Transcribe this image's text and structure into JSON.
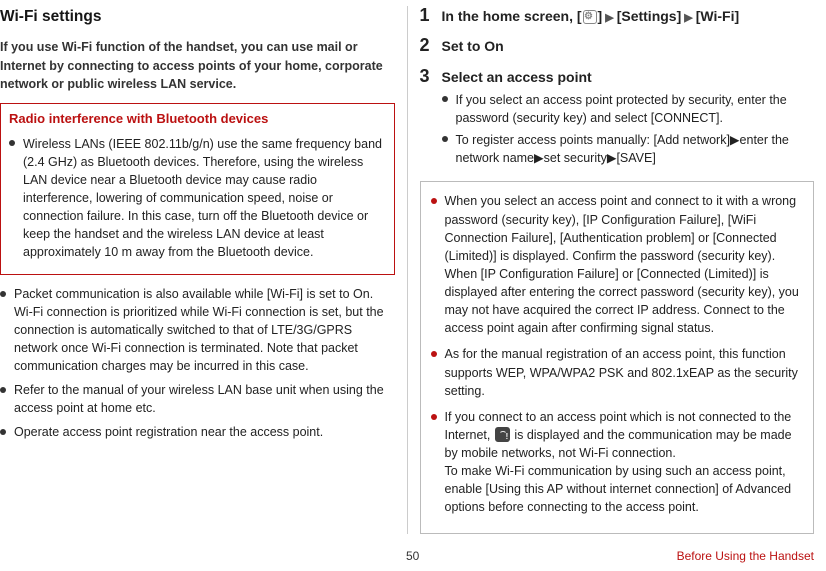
{
  "left": {
    "heading": "Wi-Fi settings",
    "intro": "If you use Wi-Fi function of the handset, you can use mail or Internet by connecting to access points of your home, corporate network or public wireless LAN service.",
    "radioBox": {
      "title": "Radio interference with Bluetooth devices",
      "body": "Wireless LANs (IEEE 802.11b/g/n) use the same frequency band (2.4 GHz) as Bluetooth devices. Therefore, using the wireless LAN device near a Bluetooth device may cause radio interference, lowering of communication speed, noise or connection failure. In this case, turn off the Bluetooth device or keep the handset and the wireless LAN device at least approximately 10 m away from the Bluetooth device."
    },
    "bullets": [
      "Packet communication is also available while [Wi-Fi] is set to On. Wi-Fi connection is prioritized while Wi-Fi connection is set, but the connection is automatically switched to that of LTE/3G/GPRS network once Wi-Fi connection is terminated. Note that packet communication charges may be incurred in this case.",
      "Refer to the manual of your wireless LAN base unit when using the access point at home etc.",
      "Operate access point registration near the access point."
    ]
  },
  "right": {
    "steps": [
      {
        "num": "1",
        "title_pre": "In the home screen, [",
        "title_mid1": "]",
        "title_mid2": "[Settings]",
        "title_tail": "[Wi-Fi]"
      },
      {
        "num": "2",
        "title": "Set to On"
      },
      {
        "num": "3",
        "title": "Select an access point",
        "subs": [
          "If you select an access point protected by security, enter the password (security key) and select [CONNECT].",
          "To register access points manually: [Add network]▶enter the network name▶set security▶[SAVE]"
        ]
      }
    ],
    "notes": [
      "When you select an access point and connect to it with a wrong password (security key), [IP Configuration Failure], [WiFi Connection Failure], [Authentication problem] or [Connected (Limited)] is displayed. Confirm the password (security key). When [IP Configuration Failure] or [Connected (Limited)] is displayed after entering the correct password (security key), you may not have acquired the correct IP address. Connect to the access point again after confirming signal status.",
      "As for the manual registration of an access point, this function supports WEP, WPA/WPA2 PSK and 802.1xEAP as the security setting.",
      "If you connect to an access point which is not connected to the Internet, [__ICON__] is displayed and the communication may be made by mobile networks, not Wi-Fi connection.\nTo make Wi-Fi communication by using such an access point, enable [Using this AP without internet connection] of Advanced options before connecting to the access point."
    ]
  },
  "footer": {
    "page": "50",
    "section": "Before Using the Handset"
  }
}
